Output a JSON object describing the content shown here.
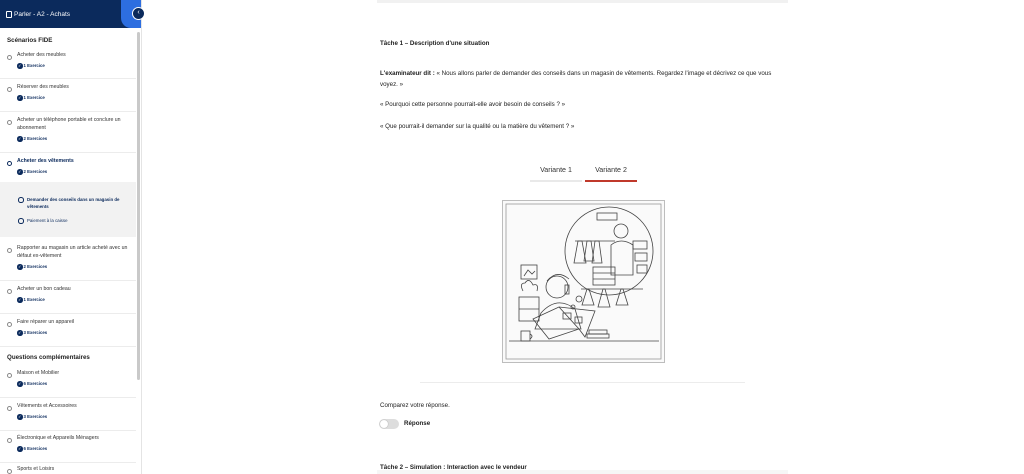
{
  "sidebar": {
    "header_title": "Parler - A2 - Achats",
    "collapse_icon": "chevron-left-icon",
    "section1_title": "Scénarios FIDE",
    "section2_title": "Questions complémentaires",
    "scenarios": [
      {
        "label": "Acheter des meubles",
        "badge": "1 Exercice"
      },
      {
        "label": "Réserver des meubles",
        "badge": "1 Exercice"
      },
      {
        "label": "Acheter un téléphone portable et conclure un abonnement",
        "badge": "2 Exercices"
      },
      {
        "label": "Acheter des vêtements",
        "badge": "2 Exercices",
        "active": true
      },
      {
        "label": "Rapporter au magasin un article acheté avec un défaut ex-vêtement",
        "badge": "2 Exercices"
      },
      {
        "label": "Acheter un bon cadeau",
        "badge": "1 Exercice"
      },
      {
        "label": "Faire réparer un appareil",
        "badge": "3 Exercices"
      }
    ],
    "sub_items": [
      {
        "label": "Demander des conseils dans un magasin de vêtements",
        "current": true
      },
      {
        "label": "Paiement à la caisse",
        "current": false
      }
    ],
    "questions": [
      {
        "label": "Maison et Mobilier",
        "badge": "6 Exercices"
      },
      {
        "label": "Vêtements et Accessoires",
        "badge": "3 Exercices"
      },
      {
        "label": "Électronique et Appareils Ménagers",
        "badge": "6 Exercices"
      },
      {
        "label": "Sports et Loisirs",
        "badge": ""
      }
    ]
  },
  "main": {
    "task1_title": "Tâche 1 – Description d'une situation",
    "examiner_label": "L'examinateur dit :",
    "examiner_text": " « Nous allons parler de demander des conseils dans un magasin de vêtements. Regardez l'image et décrivez ce que vous voyez. »",
    "question1": "« Pourquoi cette personne pourrait-elle avoir besoin de conseils ? »",
    "question2": "« Que pourrait-il demander sur la qualité ou la matière du vêtement ? »",
    "tabs": [
      {
        "label": "Variante 1",
        "active": false
      },
      {
        "label": "Variante 2",
        "active": true
      }
    ],
    "compare_text": "Comparez votre réponse.",
    "toggle_label": "Réponse",
    "task2_title": "Tâche 2 – Simulation : Interaction avec le vendeur"
  },
  "colors": {
    "navy": "#0b2a5c",
    "accent_blue": "#2d6ee0",
    "tab_active_underline": "#c0392b"
  }
}
